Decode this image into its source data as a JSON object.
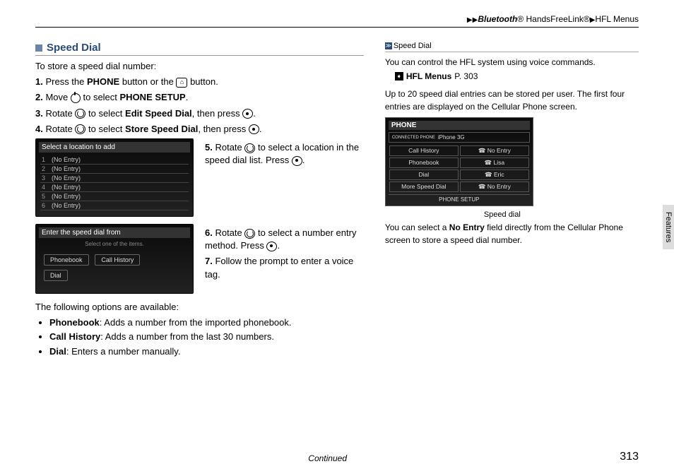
{
  "header": {
    "bluetooth": "Bluetooth",
    "reg": "®",
    "hfl1": " HandsFreeLink",
    "hfl2": "HFL Menus"
  },
  "left": {
    "section_title": "Speed Dial",
    "intro": "To store a speed dial number:",
    "s1a": "Press the ",
    "s1b": "PHONE",
    "s1c": " button or the ",
    "s1d": " button.",
    "s2a": "Move ",
    "s2b": " to select ",
    "s2c": "PHONE SETUP",
    "s2d": ".",
    "s3a": "Rotate ",
    "s3b": " to select ",
    "s3c": "Edit Speed Dial",
    "s3d": ", then press ",
    "s3e": ".",
    "s4a": "Rotate ",
    "s4b": " to select ",
    "s4c": "Store Speed Dial",
    "s4d": ", then press ",
    "s4e": ".",
    "s5a": "Rotate ",
    "s5b": " to select a location in the speed dial list. Press ",
    "s5c": ".",
    "s6a": "Rotate ",
    "s6b": " to select a number entry method. Press ",
    "s6c": ".",
    "s7": "Follow the prompt to enter a voice tag.",
    "screen1": {
      "title": "Select a location to add",
      "rows": [
        {
          "n": "1",
          "e": "(No Entry)"
        },
        {
          "n": "2",
          "e": "(No Entry)"
        },
        {
          "n": "3",
          "e": "(No Entry)"
        },
        {
          "n": "4",
          "e": "(No Entry)"
        },
        {
          "n": "5",
          "e": "(No Entry)"
        },
        {
          "n": "6",
          "e": "(No Entry)"
        }
      ]
    },
    "screen2": {
      "title": "Enter the speed dial from",
      "opts": [
        "Phonebook",
        "Call History",
        "Dial"
      ]
    },
    "avail": "The following options are available:",
    "b1a": "Phonebook",
    "b1b": ": Adds a number from the imported phonebook.",
    "b2a": "Call History",
    "b2b": ": Adds a number from the last 30 numbers.",
    "b3a": "Dial",
    "b3b": ": Enters a number manually."
  },
  "right": {
    "title": "Speed Dial",
    "p1": "You can control the HFL system using voice commands.",
    "link_label": "HFL Menus",
    "link_page": "P. 303",
    "p2": "Up to 20 speed dial entries can be stored per user. The first four entries are displayed on the Cellular Phone screen.",
    "screen3": {
      "title": "PHONE",
      "connected_label": "CONNECTED PHONE",
      "connected": "iPhone 3G",
      "rows": [
        [
          "Call History",
          "No Entry"
        ],
        [
          "Phonebook",
          "Lisa"
        ],
        [
          "Dial",
          "Eric"
        ],
        [
          "More Speed Dial",
          "No Entry"
        ]
      ],
      "bottom": "PHONE SETUP",
      "callout": "Speed dial"
    },
    "p3a": "You can select a ",
    "p3b": "No Entry",
    "p3c": " field directly from the Cellular Phone screen to store a speed dial number."
  },
  "footer": {
    "continued": "Continued",
    "page": "313"
  },
  "side_tab": "Features"
}
